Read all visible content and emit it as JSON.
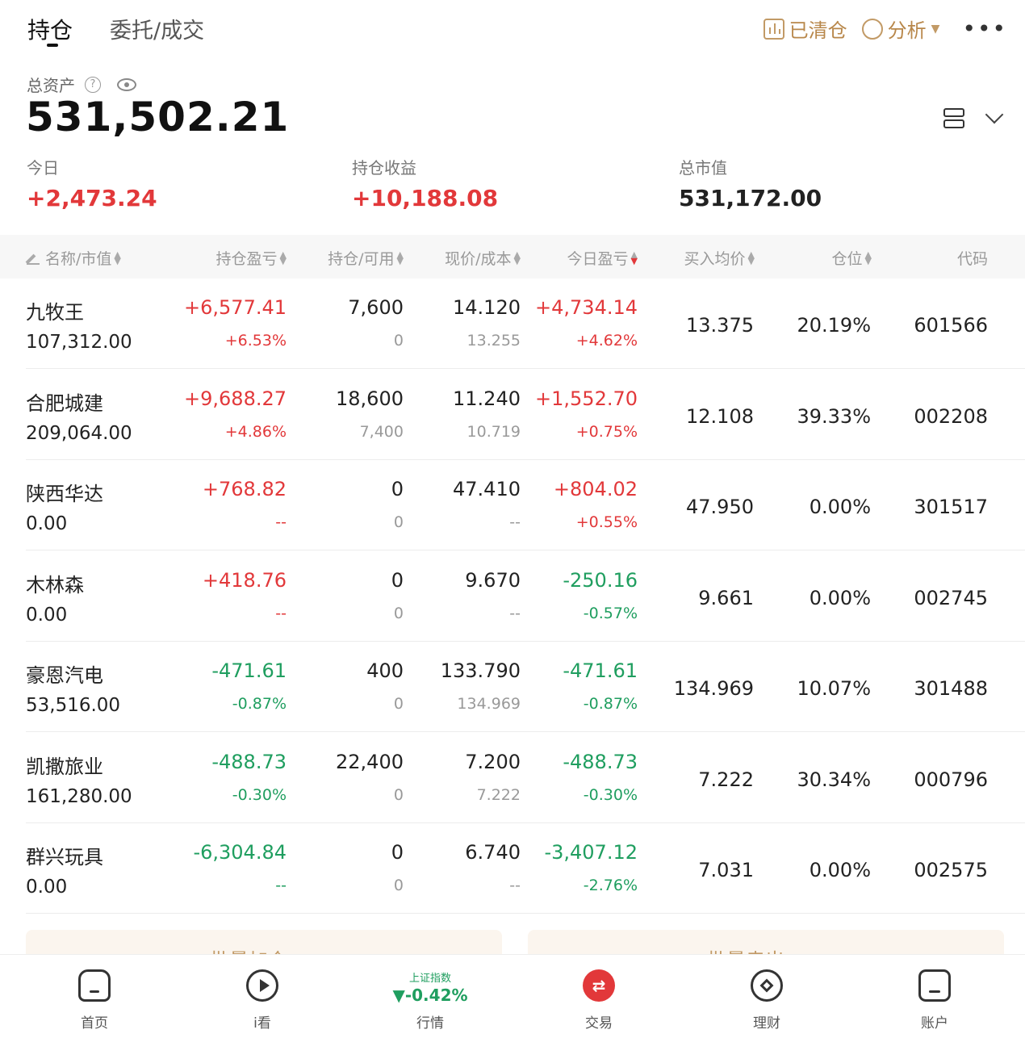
{
  "tabs": {
    "holdings": "持仓",
    "orders": "委托/成交"
  },
  "actions": {
    "cleared": "已清仓",
    "analysis": "分析",
    "more": "•••"
  },
  "assets": {
    "label": "总资产",
    "help": "?",
    "value": "531,502.21"
  },
  "summary": {
    "today_label": "今日",
    "today_value": "+2,473.24",
    "profit_label": "持仓收益",
    "profit_value": "+10,188.08",
    "market_label": "总市值",
    "market_value": "531,172.00"
  },
  "columns": {
    "name": "名称/市值",
    "pl": "持仓盈亏",
    "qty": "持仓/可用",
    "price": "现价/成本",
    "today": "今日盈亏",
    "avg": "买入均价",
    "position": "仓位",
    "code": "代码"
  },
  "rows": [
    {
      "name": "九牧王",
      "mv": "107,312.00",
      "pl": "+6,577.41",
      "pl_pct": "+6.53%",
      "pl_color": "red",
      "qty": "7,600",
      "avail": "0",
      "price": "14.120",
      "cost": "13.255",
      "today": "+4,734.14",
      "today_pct": "+4.62%",
      "today_color": "red",
      "avg": "13.375",
      "position": "20.19%",
      "code": "601566"
    },
    {
      "name": "合肥城建",
      "mv": "209,064.00",
      "pl": "+9,688.27",
      "pl_pct": "+4.86%",
      "pl_color": "red",
      "qty": "18,600",
      "avail": "7,400",
      "price": "11.240",
      "cost": "10.719",
      "today": "+1,552.70",
      "today_pct": "+0.75%",
      "today_color": "red",
      "avg": "12.108",
      "position": "39.33%",
      "code": "002208"
    },
    {
      "name": "陕西华达",
      "mv": "0.00",
      "pl": "+768.82",
      "pl_pct": "--",
      "pl_color": "red",
      "qty": "0",
      "avail": "0",
      "price": "47.410",
      "cost": "--",
      "today": "+804.02",
      "today_pct": "+0.55%",
      "today_color": "red",
      "avg": "47.950",
      "position": "0.00%",
      "code": "301517"
    },
    {
      "name": "木林森",
      "mv": "0.00",
      "pl": "+418.76",
      "pl_pct": "--",
      "pl_color": "red",
      "qty": "0",
      "avail": "0",
      "price": "9.670",
      "cost": "--",
      "today": "-250.16",
      "today_pct": "-0.57%",
      "today_color": "green",
      "avg": "9.661",
      "position": "0.00%",
      "code": "002745"
    },
    {
      "name": "豪恩汽电",
      "mv": "53,516.00",
      "pl": "-471.61",
      "pl_pct": "-0.87%",
      "pl_color": "green",
      "qty": "400",
      "avail": "0",
      "price": "133.790",
      "cost": "134.969",
      "today": "-471.61",
      "today_pct": "-0.87%",
      "today_color": "green",
      "avg": "134.969",
      "position": "10.07%",
      "code": "301488"
    },
    {
      "name": "凯撒旅业",
      "mv": "161,280.00",
      "pl": "-488.73",
      "pl_pct": "-0.30%",
      "pl_color": "green",
      "qty": "22,400",
      "avail": "0",
      "price": "7.200",
      "cost": "7.222",
      "today": "-488.73",
      "today_pct": "-0.30%",
      "today_color": "green",
      "avg": "7.222",
      "position": "30.34%",
      "code": "000796"
    },
    {
      "name": "群兴玩具",
      "mv": "0.00",
      "pl": "-6,304.84",
      "pl_pct": "--",
      "pl_color": "green",
      "qty": "0",
      "avail": "0",
      "price": "6.740",
      "cost": "--",
      "today": "-3,407.12",
      "today_pct": "-2.76%",
      "today_color": "green",
      "avg": "7.031",
      "position": "0.00%",
      "code": "002575"
    }
  ],
  "batch": {
    "add": "批量加仓",
    "sell": "批量卖出"
  },
  "index": {
    "name": "上证指数",
    "value": "▼-0.42%"
  },
  "nav": {
    "home": "首页",
    "watch": "i看",
    "market": "行情",
    "trade": "交易",
    "trade_icon": "⇄",
    "finance": "理财",
    "account": "账户"
  },
  "colors": {
    "up": "#e2383a",
    "down": "#1f9e5f",
    "accent": "#c29a66"
  }
}
